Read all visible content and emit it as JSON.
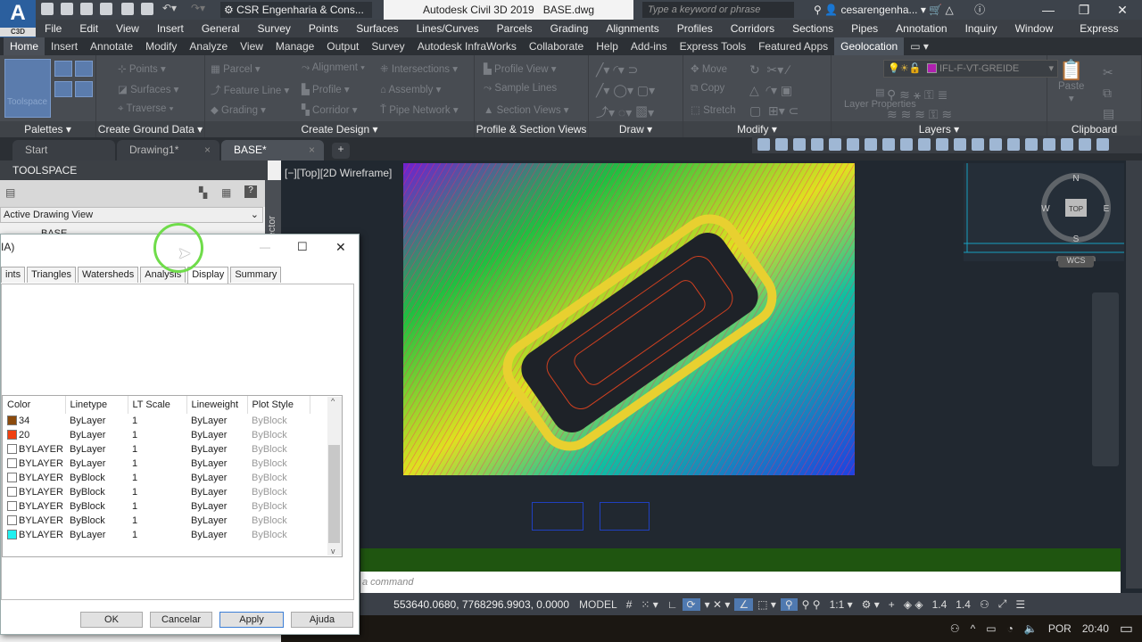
{
  "app": {
    "logo_text": "A",
    "logo_sub": "C3D",
    "title": "Autodesk Civil 3D 2019",
    "file": "BASE.dwg",
    "workspace": "CSR Engenharia & Cons...",
    "search_placeholder": "Type a keyword or phrase",
    "user": "cesarengenha...",
    "win_min": "—",
    "win_max": "❐",
    "win_close": "✕"
  },
  "menu": [
    "File",
    "Edit",
    "View",
    "Insert",
    "General",
    "Survey",
    "Points",
    "Surfaces",
    "Lines/Curves",
    "Parcels",
    "Grading",
    "Alignments",
    "Profiles",
    "Corridors",
    "Sections",
    "Pipes",
    "Annotation",
    "Inquiry",
    "Window",
    "Express"
  ],
  "ribbon_tabs": [
    "Home",
    "Insert",
    "Annotate",
    "Modify",
    "Analyze",
    "View",
    "Manage",
    "Output",
    "Survey",
    "Autodesk InfraWorks",
    "Collaborate",
    "Help",
    "Add-ins",
    "Express Tools",
    "Featured Apps",
    "Geolocation"
  ],
  "ribbon": {
    "palettes": {
      "title": "Palettes",
      "toolspace": "Toolspace"
    },
    "ground": {
      "title": "Create Ground Data",
      "items": [
        "Points",
        "Surfaces",
        "Traverse"
      ]
    },
    "design": {
      "title": "Create Design",
      "items": [
        "Parcel",
        "Feature Line",
        "Grading",
        "Alignment",
        "Profile",
        "Corridor",
        "Intersections",
        "Assembly",
        "Pipe Network"
      ]
    },
    "psv": {
      "title": "Profile & Section Views",
      "items": [
        "Profile View",
        "Sample Lines",
        "Section Views"
      ]
    },
    "draw": {
      "title": "Draw"
    },
    "modify": {
      "title": "Modify",
      "items": [
        "Move",
        "Copy",
        "Stretch"
      ]
    },
    "layers": {
      "title": "Layers",
      "current_layer": "IFL-F-VT-GREIDE",
      "layer_color": "#b020b0",
      "layer_props": "Layer Properties"
    },
    "clipboard": {
      "title": "Clipboard",
      "paste": "Paste"
    }
  },
  "file_tabs": [
    {
      "label": "Start"
    },
    {
      "label": "Drawing1*"
    },
    {
      "label": "BASE*",
      "active": true
    }
  ],
  "toolspace": {
    "title": "TOOLSPACE",
    "view": "Active Drawing View",
    "side_label": "Prospector",
    "tree_item": "BASE"
  },
  "viewport": {
    "label": "[−][Top][2D Wireframe]",
    "viewcube": {
      "top": "TOP",
      "n": "N",
      "s": "S",
      "e": "E",
      "w": "W",
      "wcs": "WCS"
    }
  },
  "dialog": {
    "title": "IA)",
    "tabs": [
      "ints",
      "Triangles",
      "Watersheds",
      "Analysis",
      "Display",
      "Summary"
    ],
    "active_tab": "Display",
    "columns": [
      "Color",
      "Linetype",
      "LT Scale",
      "Lineweight",
      "Plot Style"
    ],
    "rows": [
      {
        "color": "34",
        "swatch": "#8b4a0c",
        "linetype": "ByLayer",
        "lt_scale": "1",
        "lineweight": "ByLayer",
        "plot_style": "ByBlock"
      },
      {
        "color": "20",
        "swatch": "#f04010",
        "linetype": "ByLayer",
        "lt_scale": "1",
        "lineweight": "ByLayer",
        "plot_style": "ByBlock"
      },
      {
        "color": "BYLAYER",
        "swatch": "#ffffff",
        "linetype": "ByLayer",
        "lt_scale": "1",
        "lineweight": "ByLayer",
        "plot_style": "ByBlock"
      },
      {
        "color": "BYLAYER",
        "swatch": "#ffffff",
        "linetype": "ByLayer",
        "lt_scale": "1",
        "lineweight": "ByLayer",
        "plot_style": "ByBlock"
      },
      {
        "color": "BYLAYER",
        "swatch": "#ffffff",
        "linetype": "ByBlock",
        "lt_scale": "1",
        "lineweight": "ByLayer",
        "plot_style": "ByBlock"
      },
      {
        "color": "BYLAYER",
        "swatch": "#ffffff",
        "linetype": "ByBlock",
        "lt_scale": "1",
        "lineweight": "ByLayer",
        "plot_style": "ByBlock"
      },
      {
        "color": "BYLAYER",
        "swatch": "#ffffff",
        "linetype": "ByBlock",
        "lt_scale": "1",
        "lineweight": "ByLayer",
        "plot_style": "ByBlock"
      },
      {
        "color": "BYLAYER",
        "swatch": "#ffffff",
        "linetype": "ByBlock",
        "lt_scale": "1",
        "lineweight": "ByLayer",
        "plot_style": "ByBlock"
      },
      {
        "color": "BYLAYER",
        "swatch": "#20f0f0",
        "linetype": "ByLayer",
        "lt_scale": "1",
        "lineweight": "ByLayer",
        "plot_style": "ByBlock"
      }
    ],
    "buttons": {
      "ok": "OK",
      "cancel": "Cancelar",
      "apply": "Apply",
      "help": "Ajuda"
    }
  },
  "command": {
    "placeholder": "a command"
  },
  "status": {
    "coords": "553640.0680, 7768296.9903, 0.0000",
    "model": "MODEL",
    "scale": "1:1",
    "v1": "1.4",
    "v2": "1.4"
  },
  "taskbar": {
    "lang": "POR",
    "time": "20:40"
  }
}
